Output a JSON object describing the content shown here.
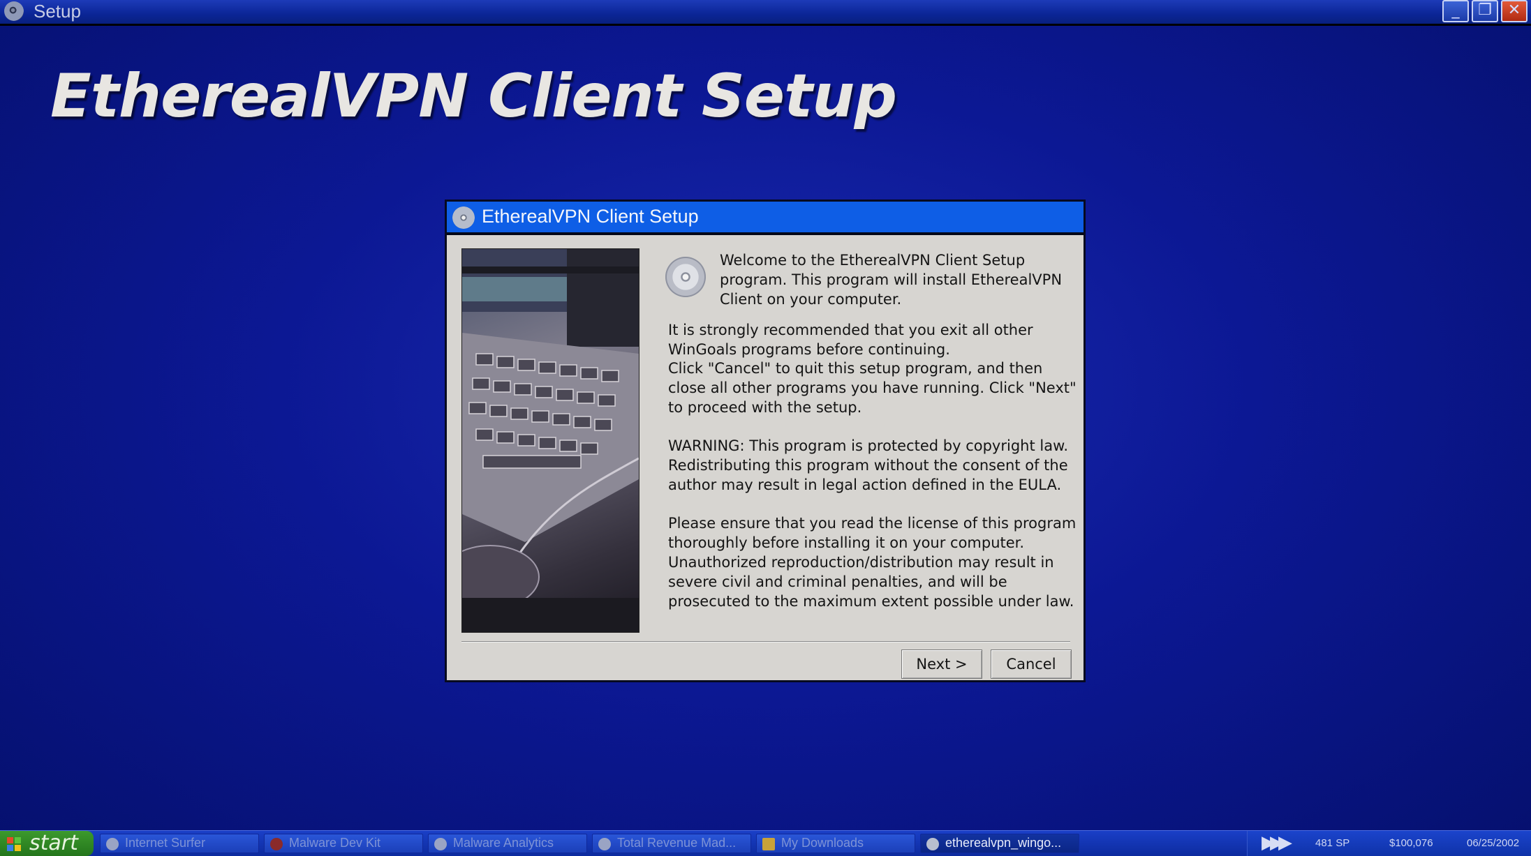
{
  "window": {
    "title": "Setup",
    "controls": {
      "minimize": "_",
      "maximize": "❐",
      "close": "✕"
    }
  },
  "heading": "EtherealVPN Client Setup",
  "dialog": {
    "title": "EtherealVPN Client Setup",
    "intro": "Welcome to the EtherealVPN Client Setup program. This program will install EtherealVPN Client on your computer.",
    "paragraphs": [
      "It is strongly recommended that you exit all other WinGoals programs before continuing.",
      "Click \"Cancel\" to quit this setup program, and then close all other programs you have running. Click \"Next\" to proceed with the setup.",
      "WARNING: This program is protected by copyright law. Redistributing this program without the consent of the author may result in legal action defined in the EULA.",
      "Please ensure that you read the license of this program thoroughly before installing it on your computer. Unauthorized reproduction/distribution may result in severe civil and criminal penalties, and will be prosecuted to the maximum extent possible under law."
    ],
    "buttons": {
      "next": "Next >",
      "cancel": "Cancel"
    }
  },
  "taskbar": {
    "start_label": "start",
    "tasks": [
      {
        "label": "Internet Surfer",
        "icon": "globe-icon"
      },
      {
        "label": "Malware Dev Kit",
        "icon": "bug-icon"
      },
      {
        "label": "Malware Analytics",
        "icon": "chart-icon"
      },
      {
        "label": "Total Revenue Mad...",
        "icon": "gear-icon"
      },
      {
        "label": "My Downloads",
        "icon": "folder-icon"
      },
      {
        "label": "etherealvpn_wingo...",
        "icon": "cd-icon"
      }
    ],
    "tray": {
      "arrows": "▶▶▶",
      "sp": "481 SP",
      "money": "$100,076",
      "date": "06/25/2002"
    }
  },
  "colors": {
    "desktop": "#0c1894",
    "titlebar": "#0b2596",
    "dialog_title": "#0e5ee6",
    "dialog_body": "#d7d5d1",
    "start": "#24761c"
  }
}
